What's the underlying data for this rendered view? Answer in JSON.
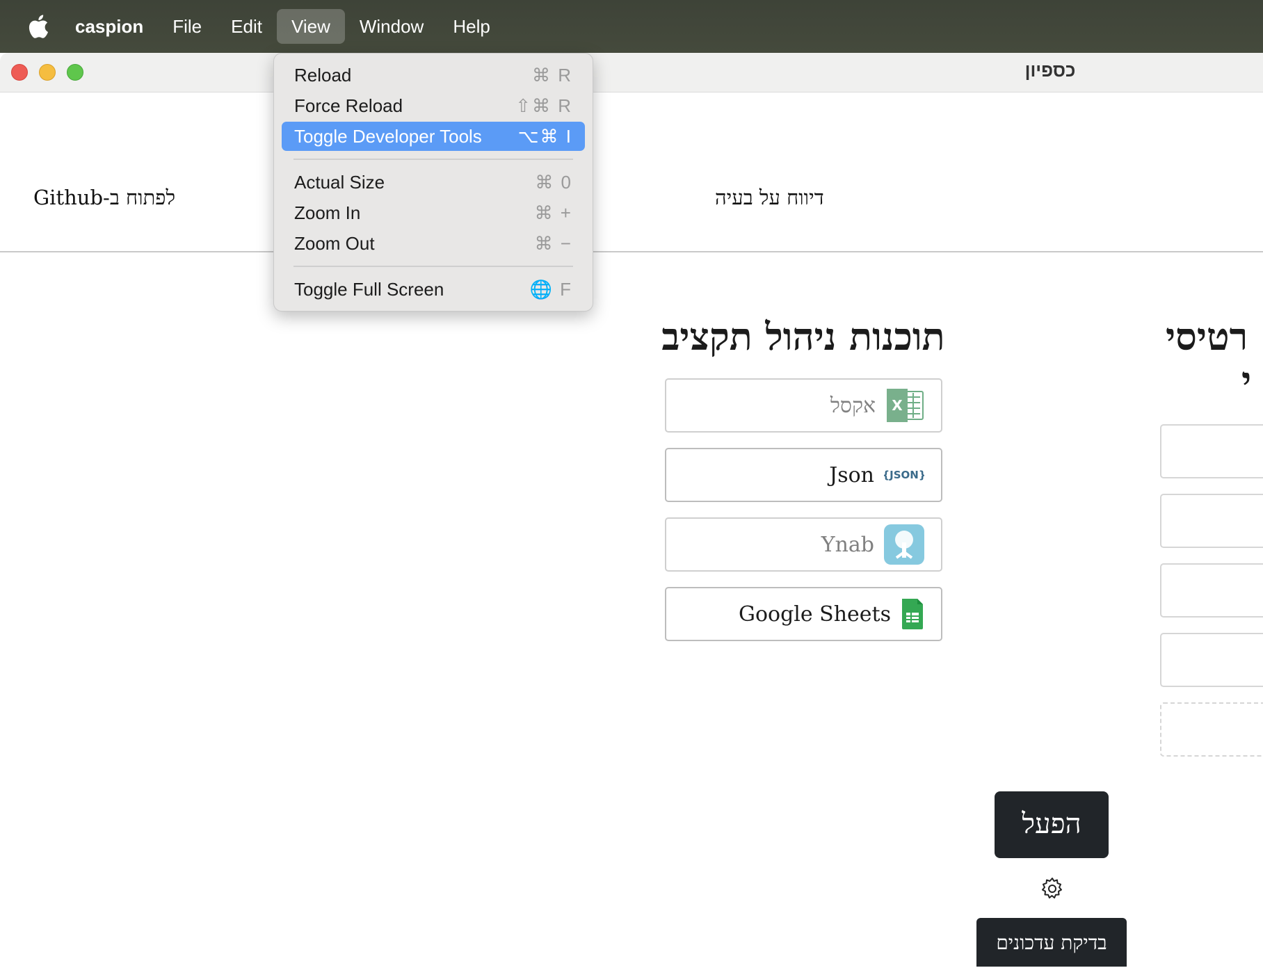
{
  "menubar": {
    "app_name": "caspion",
    "menus": [
      "File",
      "Edit",
      "View",
      "Window",
      "Help"
    ],
    "active_menu": "View"
  },
  "view_menu": {
    "items": [
      {
        "label": "Reload",
        "shortcut": "⌘ R"
      },
      {
        "label": "Force Reload",
        "shortcut": "⇧⌘ R"
      },
      {
        "label": "Toggle Developer Tools",
        "shortcut": "⌥⌘ I"
      },
      {
        "label": "Actual Size",
        "shortcut": "⌘ 0"
      },
      {
        "label": "Zoom In",
        "shortcut": "⌘ +"
      },
      {
        "label": "Zoom Out",
        "shortcut": "⌘ −"
      },
      {
        "label": "Toggle Full Screen",
        "shortcut": "🌐 F"
      }
    ],
    "highlighted": "Toggle Developer Tools"
  },
  "window": {
    "title": "כספיון"
  },
  "topbar": {
    "github_link": "לפתוח ב-Github",
    "report_link": "דיווח על בעיה"
  },
  "budget_section": {
    "title": "תוכנות ניהול תקציב",
    "options": [
      {
        "label": "אקסל",
        "icon": "excel-icon",
        "selected": false
      },
      {
        "label": "Json",
        "icon": "json-icon",
        "selected": true
      },
      {
        "label": "Ynab",
        "icon": "ynab-icon",
        "selected": false
      },
      {
        "label": "Google Sheets",
        "icon": "google-sheets-icon",
        "selected": true
      }
    ]
  },
  "accounts_section": {
    "title_line1": "רטיסי",
    "title_line2": "י"
  },
  "actions": {
    "run_label": "הפעל",
    "update_label": "בדיקת עדכונים"
  },
  "colors": {
    "menu_highlight": "#5b9bf6",
    "button_dark": "#212529",
    "excel_green": "#1d7044",
    "sheets_green": "#34a853",
    "ynab_blue": "#7fc4dd"
  }
}
